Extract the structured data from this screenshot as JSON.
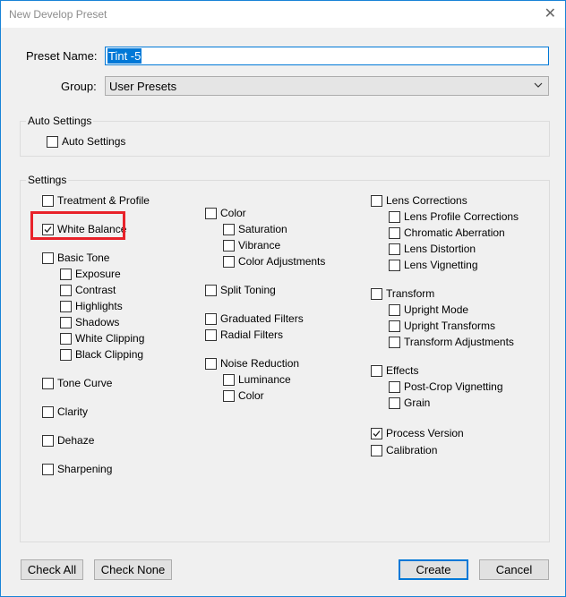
{
  "window": {
    "title": "New Develop Preset",
    "close_symbol": "✕"
  },
  "preset": {
    "name_label": "Preset Name:",
    "name_value": "Tint -5",
    "group_label": "Group:",
    "group_value": "User Presets"
  },
  "auto_settings": {
    "legend": "Auto Settings",
    "label": "Auto Settings",
    "checked": false
  },
  "settings": {
    "legend": "Settings",
    "col1": [
      {
        "label": "Treatment & Profile",
        "checked": false
      },
      {
        "label": "White Balance",
        "checked": true,
        "highlighted": true
      },
      {
        "label": "Basic Tone",
        "checked": false
      },
      {
        "label": "Exposure",
        "checked": false
      },
      {
        "label": "Contrast",
        "checked": false
      },
      {
        "label": "Highlights",
        "checked": false
      },
      {
        "label": "Shadows",
        "checked": false
      },
      {
        "label": "White Clipping",
        "checked": false
      },
      {
        "label": "Black Clipping",
        "checked": false
      },
      {
        "label": "Tone Curve",
        "checked": false
      },
      {
        "label": "Clarity",
        "checked": false
      },
      {
        "label": "Dehaze",
        "checked": false
      },
      {
        "label": "Sharpening",
        "checked": false
      }
    ],
    "col2": [
      {
        "label": "Color",
        "checked": false
      },
      {
        "label": "Saturation",
        "checked": false
      },
      {
        "label": "Vibrance",
        "checked": false
      },
      {
        "label": "Color Adjustments",
        "checked": false
      },
      {
        "label": "Split Toning",
        "checked": false
      },
      {
        "label": "Graduated Filters",
        "checked": false
      },
      {
        "label": "Radial Filters",
        "checked": false
      },
      {
        "label": "Noise Reduction",
        "checked": false
      },
      {
        "label": "Luminance",
        "checked": false
      },
      {
        "label": "Color",
        "checked": false
      }
    ],
    "col3": [
      {
        "label": "Lens Corrections",
        "checked": false
      },
      {
        "label": "Lens Profile Corrections",
        "checked": false
      },
      {
        "label": "Chromatic Aberration",
        "checked": false
      },
      {
        "label": "Lens Distortion",
        "checked": false
      },
      {
        "label": "Lens Vignetting",
        "checked": false
      },
      {
        "label": "Transform",
        "checked": false
      },
      {
        "label": "Upright Mode",
        "checked": false
      },
      {
        "label": "Upright Transforms",
        "checked": false
      },
      {
        "label": "Transform Adjustments",
        "checked": false
      },
      {
        "label": "Effects",
        "checked": false
      },
      {
        "label": "Post-Crop Vignetting",
        "checked": false
      },
      {
        "label": "Grain",
        "checked": false
      },
      {
        "label": "Process Version",
        "checked": true
      },
      {
        "label": "Calibration",
        "checked": false
      }
    ]
  },
  "buttons": {
    "check_all": "Check All",
    "check_none": "Check None",
    "create": "Create",
    "cancel": "Cancel"
  },
  "colors": {
    "accent": "#0078d7",
    "highlight_box": "#e8222a",
    "window_border": "#1883d7"
  }
}
